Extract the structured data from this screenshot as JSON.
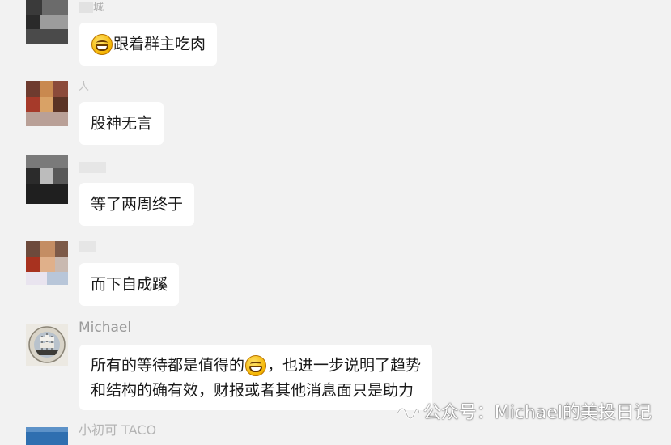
{
  "messages": [
    {
      "name": "城",
      "text_before": "",
      "emoji": "grinning-face",
      "text": "跟着群主吃肉"
    },
    {
      "name": "人",
      "text_before": "",
      "emoji": "",
      "text": "股神无言"
    },
    {
      "name": "",
      "text_before": "",
      "emoji": "",
      "text": "等了两周终于"
    },
    {
      "name": "",
      "text_before": "",
      "emoji": "",
      "text": "而下自成蹊"
    },
    {
      "name": "Michael",
      "line1_before": "所有的等待都是值得的",
      "emoji": "grinning-face",
      "line1_after": "，也进一步说明了趋势",
      "line2": "和结构的确有效，财报或者其他消息面只是助力"
    },
    {
      "name": "小初可 TACO"
    }
  ],
  "watermark": {
    "text": "公众号：Michael的美投日记",
    "icon": "wechat-channel-icon"
  },
  "colors": {
    "background": "#f2f2f2",
    "bubble": "#ffffff",
    "name": "#9a9a9a"
  }
}
